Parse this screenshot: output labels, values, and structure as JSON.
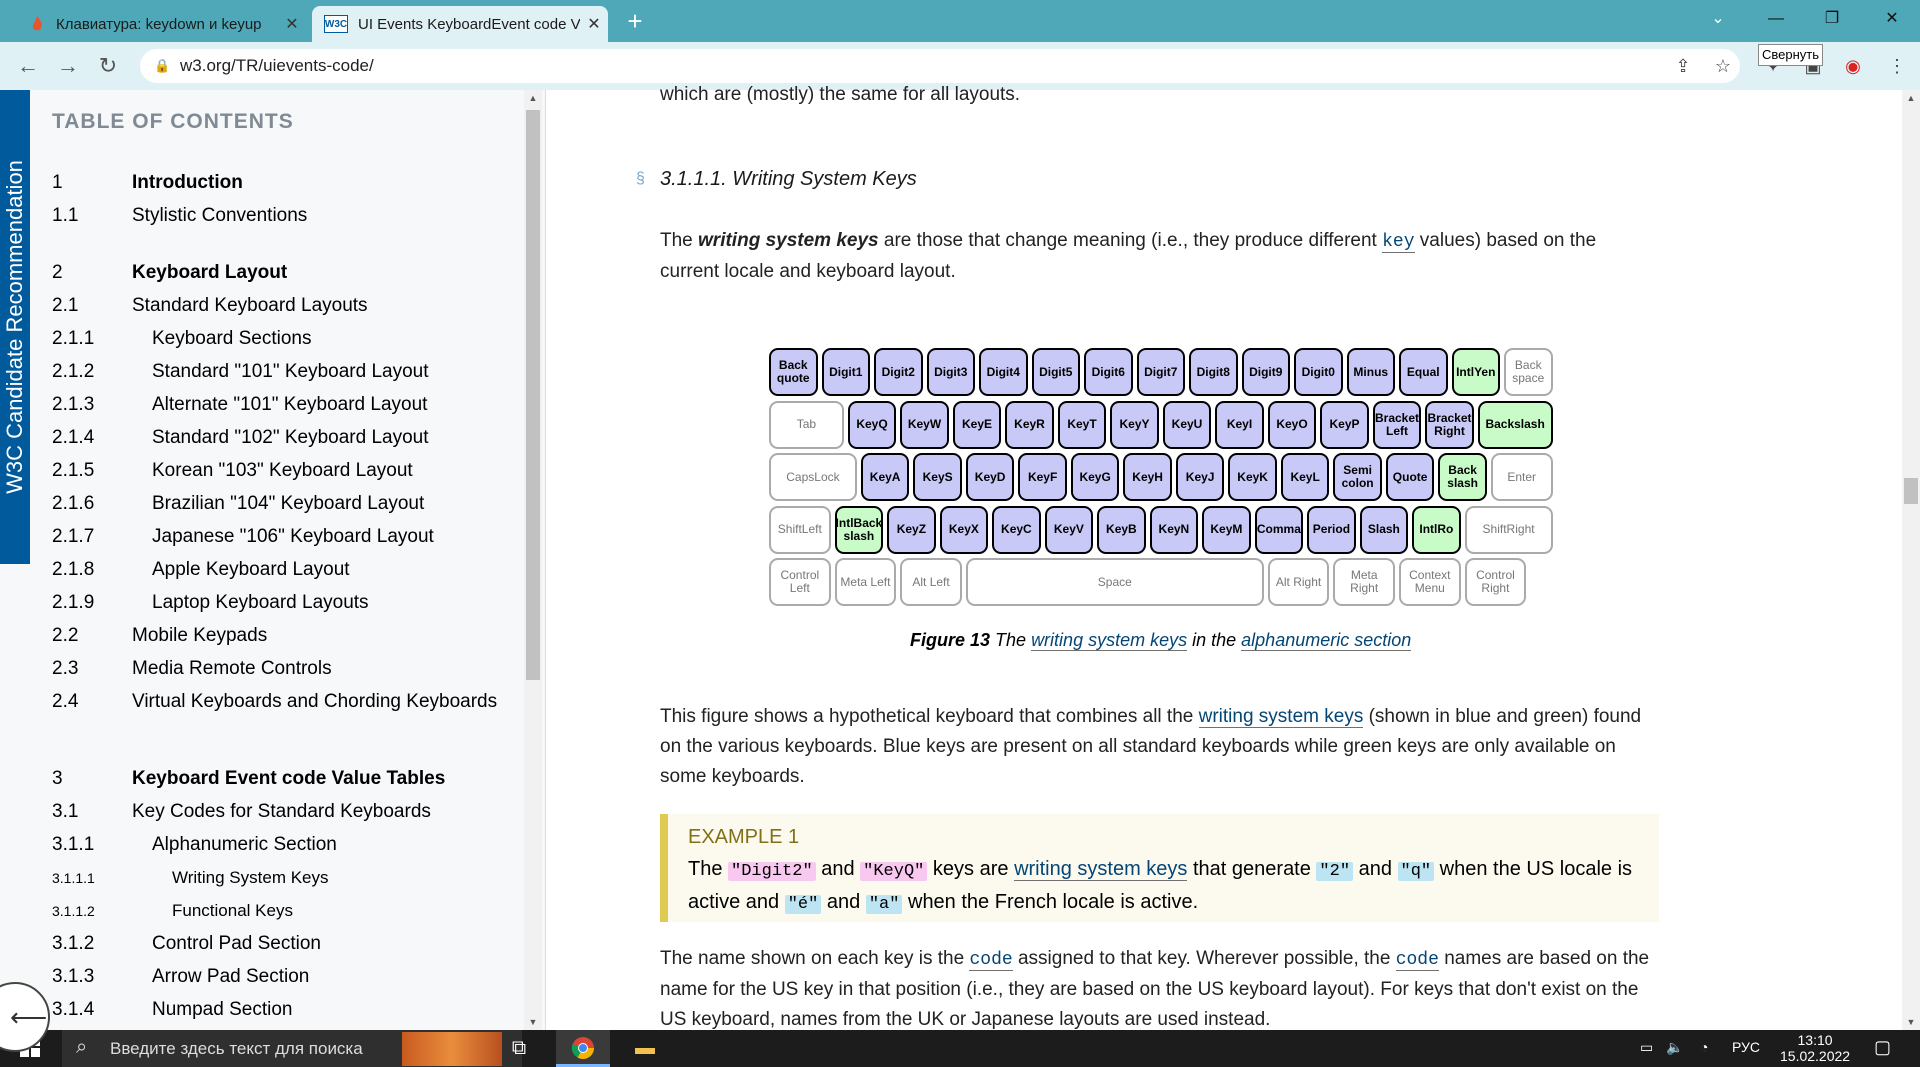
{
  "browser": {
    "tabs": [
      {
        "title": "Клавиатура: keydown и keyup",
        "favicon": "flame-icon"
      },
      {
        "title": "UI Events KeyboardEvent code Va",
        "favicon": "w3c-icon",
        "favicon_text": "W3C"
      }
    ],
    "url": "w3.org/TR/uievents-code/",
    "tooltip": "Свернуть",
    "accent_color": "#4fa8b8"
  },
  "sidebar": {
    "stamp": "W3C Candidate Recommendation",
    "toc_heading": "TABLE OF CONTENTS",
    "items": [
      {
        "num": "1",
        "label": "Introduction"
      },
      {
        "num": "1.1",
        "label": "Stylistic Conventions"
      },
      {
        "num": "2",
        "label": "Keyboard Layout"
      },
      {
        "num": "2.1",
        "label": "Standard Keyboard Layouts"
      },
      {
        "num": "2.1.1",
        "label": "Keyboard Sections"
      },
      {
        "num": "2.1.2",
        "label": "Standard \"101\" Keyboard Layout"
      },
      {
        "num": "2.1.3",
        "label": "Alternate \"101\" Keyboard Layout"
      },
      {
        "num": "2.1.4",
        "label": "Standard \"102\" Keyboard Layout"
      },
      {
        "num": "2.1.5",
        "label": "Korean \"103\" Keyboard Layout"
      },
      {
        "num": "2.1.6",
        "label": "Brazilian \"104\" Keyboard Layout"
      },
      {
        "num": "2.1.7",
        "label": "Japanese \"106\" Keyboard Layout"
      },
      {
        "num": "2.1.8",
        "label": "Apple Keyboard Layout"
      },
      {
        "num": "2.1.9",
        "label": "Laptop Keyboard Layouts"
      },
      {
        "num": "2.2",
        "label": "Mobile Keypads"
      },
      {
        "num": "2.3",
        "label": "Media Remote Controls"
      },
      {
        "num": "2.4",
        "label": "Virtual Keyboards and Chording Keyboards"
      },
      {
        "num": "3",
        "label": "Keyboard Event code Value Tables"
      },
      {
        "num": "3.1",
        "label": "Key Codes for Standard Keyboards"
      },
      {
        "num": "3.1.1",
        "label": "Alphanumeric Section"
      },
      {
        "num": "3.1.1.1",
        "label": "Writing System Keys"
      },
      {
        "num": "3.1.1.2",
        "label": "Functional Keys"
      },
      {
        "num": "3.1.2",
        "label": "Control Pad Section"
      },
      {
        "num": "3.1.3",
        "label": "Arrow Pad Section"
      },
      {
        "num": "3.1.4",
        "label": "Numpad Section"
      }
    ]
  },
  "main": {
    "top_line": "which are (mostly) the same for all layouts.",
    "section_mark": "§",
    "section_heading": "3.1.1.1. Writing System Keys",
    "intro_p1": "The ",
    "intro_bold": "writing system keys",
    "intro_p2": " are those that change meaning (i.e., they produce different ",
    "intro_code": "key",
    "intro_p3": " values) based on the current locale and keyboard layout.",
    "caption_fig": "Figure 13",
    "caption_the": " The ",
    "caption_link1": "writing system keys",
    "caption_in": " in the ",
    "caption_link2": "alphanumeric section",
    "para2_a": "This figure shows a hypothetical keyboard that combines all the ",
    "para2_link": "writing system keys",
    "para2_b": " (shown in blue and green) found on the various keyboards. Blue keys are present on all standard keyboards while green keys are only available on some keyboards.",
    "example": {
      "heading": "EXAMPLE 1",
      "t1": "The ",
      "c1": "\"Digit2\"",
      "t2": " and ",
      "c2": "\"KeyQ\"",
      "t3": " keys are ",
      "link": "writing system keys",
      "t4": " that generate ",
      "c3": "\"2\"",
      "t5": " and ",
      "c4": "\"q\"",
      "t6": " when the US locale is active and ",
      "c5": "\"é\"",
      "t7": " and ",
      "c6": "\"a\"",
      "t8": " when the French locale is active."
    },
    "para3_a": "The name shown on each key is the ",
    "para3_code1": "code",
    "para3_b": " assigned to that key. Wherever possible, the ",
    "para3_code2": "code",
    "para3_c": " names are based on the name for the US key in that position (i.e., they are based on the US keyboard layout). For keys that don't exist on the US keyboard, names from the UK or Japanese layouts are used instead."
  },
  "keyboard": {
    "colors": {
      "blue": "#c9c9f7",
      "green": "#c8fbc8",
      "other": "#ffffff"
    },
    "rows": [
      [
        {
          "label": "Back quote",
          "type": "blue"
        },
        {
          "label": "Digit1",
          "type": "blue"
        },
        {
          "label": "Digit2",
          "type": "blue"
        },
        {
          "label": "Digit3",
          "type": "blue"
        },
        {
          "label": "Digit4",
          "type": "blue"
        },
        {
          "label": "Digit5",
          "type": "blue"
        },
        {
          "label": "Digit6",
          "type": "blue"
        },
        {
          "label": "Digit7",
          "type": "blue"
        },
        {
          "label": "Digit8",
          "type": "blue"
        },
        {
          "label": "Digit9",
          "type": "blue"
        },
        {
          "label": "Digit0",
          "type": "blue"
        },
        {
          "label": "Minus",
          "type": "blue"
        },
        {
          "label": "Equal",
          "type": "blue"
        },
        {
          "label": "IntlYen",
          "type": "green"
        },
        {
          "label": "Back space",
          "type": "other"
        }
      ],
      [
        {
          "label": "Tab",
          "type": "other"
        },
        {
          "label": "KeyQ",
          "type": "blue"
        },
        {
          "label": "KeyW",
          "type": "blue"
        },
        {
          "label": "KeyE",
          "type": "blue"
        },
        {
          "label": "KeyR",
          "type": "blue"
        },
        {
          "label": "KeyT",
          "type": "blue"
        },
        {
          "label": "KeyY",
          "type": "blue"
        },
        {
          "label": "KeyU",
          "type": "blue"
        },
        {
          "label": "KeyI",
          "type": "blue"
        },
        {
          "label": "KeyO",
          "type": "blue"
        },
        {
          "label": "KeyP",
          "type": "blue"
        },
        {
          "label": "Bracket Left",
          "type": "blue"
        },
        {
          "label": "Bracket Right",
          "type": "blue"
        },
        {
          "label": "Backslash",
          "type": "green"
        }
      ],
      [
        {
          "label": "CapsLock",
          "type": "other"
        },
        {
          "label": "KeyA",
          "type": "blue"
        },
        {
          "label": "KeyS",
          "type": "blue"
        },
        {
          "label": "KeyD",
          "type": "blue"
        },
        {
          "label": "KeyF",
          "type": "blue"
        },
        {
          "label": "KeyG",
          "type": "blue"
        },
        {
          "label": "KeyH",
          "type": "blue"
        },
        {
          "label": "KeyJ",
          "type": "blue"
        },
        {
          "label": "KeyK",
          "type": "blue"
        },
        {
          "label": "KeyL",
          "type": "blue"
        },
        {
          "label": "Semi colon",
          "type": "blue"
        },
        {
          "label": "Quote",
          "type": "blue"
        },
        {
          "label": "Back slash",
          "type": "green"
        },
        {
          "label": "Enter",
          "type": "other"
        }
      ],
      [
        {
          "label": "ShiftLeft",
          "type": "other"
        },
        {
          "label": "IntlBack slash",
          "type": "green"
        },
        {
          "label": "KeyZ",
          "type": "blue"
        },
        {
          "label": "KeyX",
          "type": "blue"
        },
        {
          "label": "KeyC",
          "type": "blue"
        },
        {
          "label": "KeyV",
          "type": "blue"
        },
        {
          "label": "KeyB",
          "type": "blue"
        },
        {
          "label": "KeyN",
          "type": "blue"
        },
        {
          "label": "KeyM",
          "type": "blue"
        },
        {
          "label": "Comma",
          "type": "blue"
        },
        {
          "label": "Period",
          "type": "blue"
        },
        {
          "label": "Slash",
          "type": "blue"
        },
        {
          "label": "IntlRo",
          "type": "green"
        },
        {
          "label": "ShiftRight",
          "type": "other"
        }
      ],
      [
        {
          "label": "Control Left",
          "type": "other"
        },
        {
          "label": "Meta Left",
          "type": "other"
        },
        {
          "label": "Alt Left",
          "type": "other"
        },
        {
          "label": "Space",
          "type": "other"
        },
        {
          "label": "Alt Right",
          "type": "other"
        },
        {
          "label": "Meta Right",
          "type": "other"
        },
        {
          "label": "Context Menu",
          "type": "other"
        },
        {
          "label": "Control Right",
          "type": "other"
        }
      ]
    ]
  },
  "taskbar": {
    "search_placeholder": "Введите здесь текст для поиска",
    "language": "РУС",
    "time": "13:10",
    "date": "15.02.2022"
  }
}
